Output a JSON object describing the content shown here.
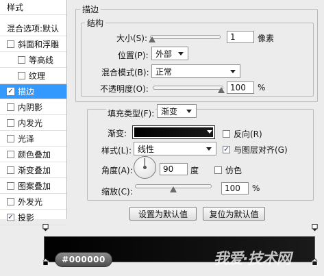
{
  "sidebar": {
    "header": "样式",
    "blend_options": "混合选项:默认",
    "items": [
      {
        "label": "斜面和浮雕",
        "checked": false,
        "indent": false,
        "selected": false
      },
      {
        "label": "等高线",
        "checked": false,
        "indent": true,
        "selected": false
      },
      {
        "label": "纹理",
        "checked": false,
        "indent": true,
        "selected": false
      },
      {
        "label": "描边",
        "checked": true,
        "indent": false,
        "selected": true
      },
      {
        "label": "内阴影",
        "checked": false,
        "indent": false,
        "selected": false
      },
      {
        "label": "内发光",
        "checked": false,
        "indent": false,
        "selected": false
      },
      {
        "label": "光泽",
        "checked": false,
        "indent": false,
        "selected": false
      },
      {
        "label": "颜色叠加",
        "checked": false,
        "indent": false,
        "selected": false
      },
      {
        "label": "渐变叠加",
        "checked": false,
        "indent": false,
        "selected": false
      },
      {
        "label": "图案叠加",
        "checked": false,
        "indent": false,
        "selected": false
      },
      {
        "label": "外发光",
        "checked": false,
        "indent": false,
        "selected": false
      },
      {
        "label": "投影",
        "checked": true,
        "indent": false,
        "selected": false
      }
    ]
  },
  "stroke": {
    "title": "描边",
    "structure_title": "结构",
    "size_label": "大小(S):",
    "size_value": "1",
    "size_unit": "像素",
    "size_fraction": 0.0,
    "position_label": "位置(P):",
    "position_value": "外部",
    "blend_label": "混合模式(B):",
    "blend_value": "正常",
    "opacity_label": "不透明度(O):",
    "opacity_value": "100",
    "opacity_unit": "%",
    "opacity_fraction": 1.0
  },
  "fill": {
    "type_label": "填充类型(F):",
    "type_value": "渐变",
    "gradient_label": "渐变:",
    "reverse_label": "反向(R)",
    "reverse_checked": false,
    "style_label": "样式(L):",
    "style_value": "线性",
    "align_label": "与图层对齐(G)",
    "align_checked": true,
    "angle_label": "角度(A):",
    "angle_value": "90",
    "angle_unit": "度",
    "dither_label": "仿色",
    "dither_checked": false,
    "scale_label": "缩放(C):",
    "scale_value": "100",
    "scale_unit": "%",
    "scale_fraction": 0.5
  },
  "buttons": {
    "set_default": "设置为默认值",
    "reset_default": "复位为默认值"
  },
  "gradient_editor": {
    "hex": "#000000",
    "watermark": "我爱·技术网"
  },
  "colors": {
    "selection": "#3399ff",
    "gradient_start": "#000000",
    "gradient_end": "#1a1a1a"
  }
}
